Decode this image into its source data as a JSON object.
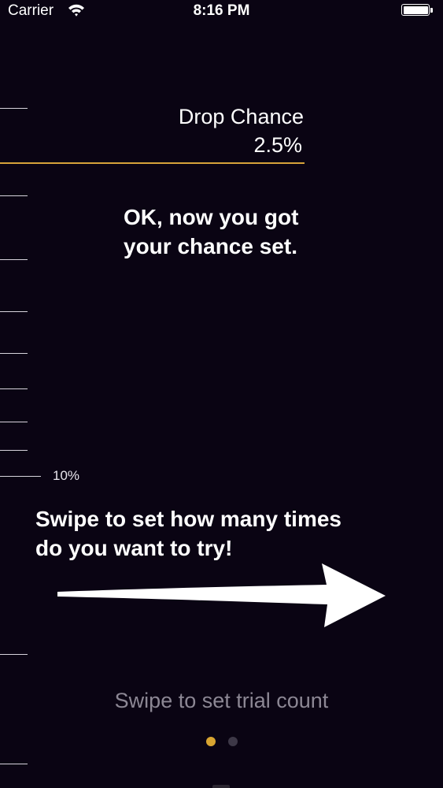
{
  "status_bar": {
    "carrier": "Carrier",
    "time": "8:16 PM",
    "wifi_icon": "wifi-icon",
    "battery_icon": "battery-icon"
  },
  "ruler": {
    "tick_label": "10%"
  },
  "drop_chance": {
    "title": "Drop Chance",
    "value": "2.5%",
    "accent_color": "#d7a33a"
  },
  "instructions": {
    "line_1": "OK, now you got",
    "line_2": "your chance set.",
    "line_3": "Swipe to set how many times",
    "line_4": "do you want to try!",
    "arrow_icon": "arrow-right-icon"
  },
  "footer": {
    "hint": "Swipe to set trial count",
    "page_indicator": {
      "pages": 2,
      "current": 1
    }
  }
}
